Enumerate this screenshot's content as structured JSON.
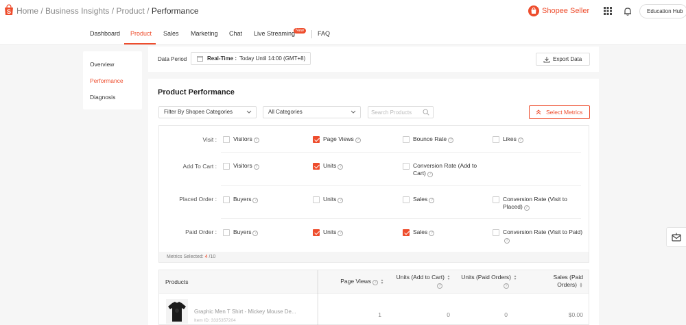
{
  "topbar": {
    "breadcrumb": [
      "Home",
      "Business Insights",
      "Product"
    ],
    "breadcrumb_current": "Performance",
    "separator": "/",
    "seller_brand": "Shopee Seller",
    "education_hub": "Education Hub"
  },
  "nav": {
    "tabs": [
      "Dashboard",
      "Product",
      "Sales",
      "Marketing",
      "Chat",
      "Live Streaming",
      "FAQ"
    ],
    "active_tab": "Product",
    "new_badge": "New"
  },
  "sidebar": {
    "items": [
      "Overview",
      "Performance",
      "Diagnosis"
    ],
    "active": "Performance"
  },
  "period": {
    "label": "Data Period",
    "mode": "Real-Time :",
    "value": "Today Until 14:00 (GMT+8)",
    "export_label": "Export Data"
  },
  "product_performance": {
    "title": "Product Performance",
    "filter_select": "Filter By Shopee Categories",
    "category_select": "All Categories",
    "search_placeholder": "Search Products",
    "select_metrics_label": "Select Metrics"
  },
  "metrics": {
    "rows": [
      {
        "label": "Visit :",
        "items": [
          {
            "text": "Visitors",
            "checked": false
          },
          {
            "text": "Page Views",
            "checked": true
          },
          {
            "text": "Bounce Rate",
            "checked": false
          },
          {
            "text": "Likes",
            "checked": false
          }
        ]
      },
      {
        "label": "Add To Cart :",
        "items": [
          {
            "text": "Visitors",
            "checked": false
          },
          {
            "text": "Units",
            "checked": true
          },
          {
            "text": "Conversion Rate (Add to Cart)",
            "checked": false
          }
        ]
      },
      {
        "label": "Placed Order :",
        "items": [
          {
            "text": "Buyers",
            "checked": false
          },
          {
            "text": "Units",
            "checked": false
          },
          {
            "text": "Sales",
            "checked": false
          },
          {
            "text": "Conversion Rate (Visit to Placed)",
            "checked": false
          }
        ]
      },
      {
        "label": "Paid Order :",
        "items": [
          {
            "text": "Buyers",
            "checked": false
          },
          {
            "text": "Units",
            "checked": true
          },
          {
            "text": "Sales",
            "checked": true
          },
          {
            "text": "Conversion Rate (Visit to Paid)",
            "checked": false
          }
        ]
      }
    ],
    "footer_label": "Metrics Selected:",
    "selected_count": "4",
    "max_count": "/10"
  },
  "table": {
    "columns": [
      "Products",
      "Page Views",
      "Units (Add to Cart)",
      "Units (Paid Orders)",
      "Sales (Paid Orders)"
    ],
    "rows": [
      {
        "name": "Graphic Men T Shirt - Mickey Mouse De...",
        "item_id": "Item ID: 3335357204",
        "page_views": "1",
        "units_cart": "0",
        "units_paid": "0",
        "sales_paid": "$0.00"
      }
    ]
  },
  "icons": {
    "logo": "shopee-bag-icon",
    "grid": "apps-grid-icon",
    "bell": "notification-bell-icon",
    "calendar": "calendar-icon",
    "export": "download-icon",
    "chevron": "chevron-down-icon",
    "search": "search-icon",
    "metrics": "chevron-double-up-icon",
    "help": "question-mark-icon",
    "chat_float": "mail-icon"
  },
  "colors": {
    "accent": "#ee4d2d",
    "background": "#f6f6f6"
  }
}
